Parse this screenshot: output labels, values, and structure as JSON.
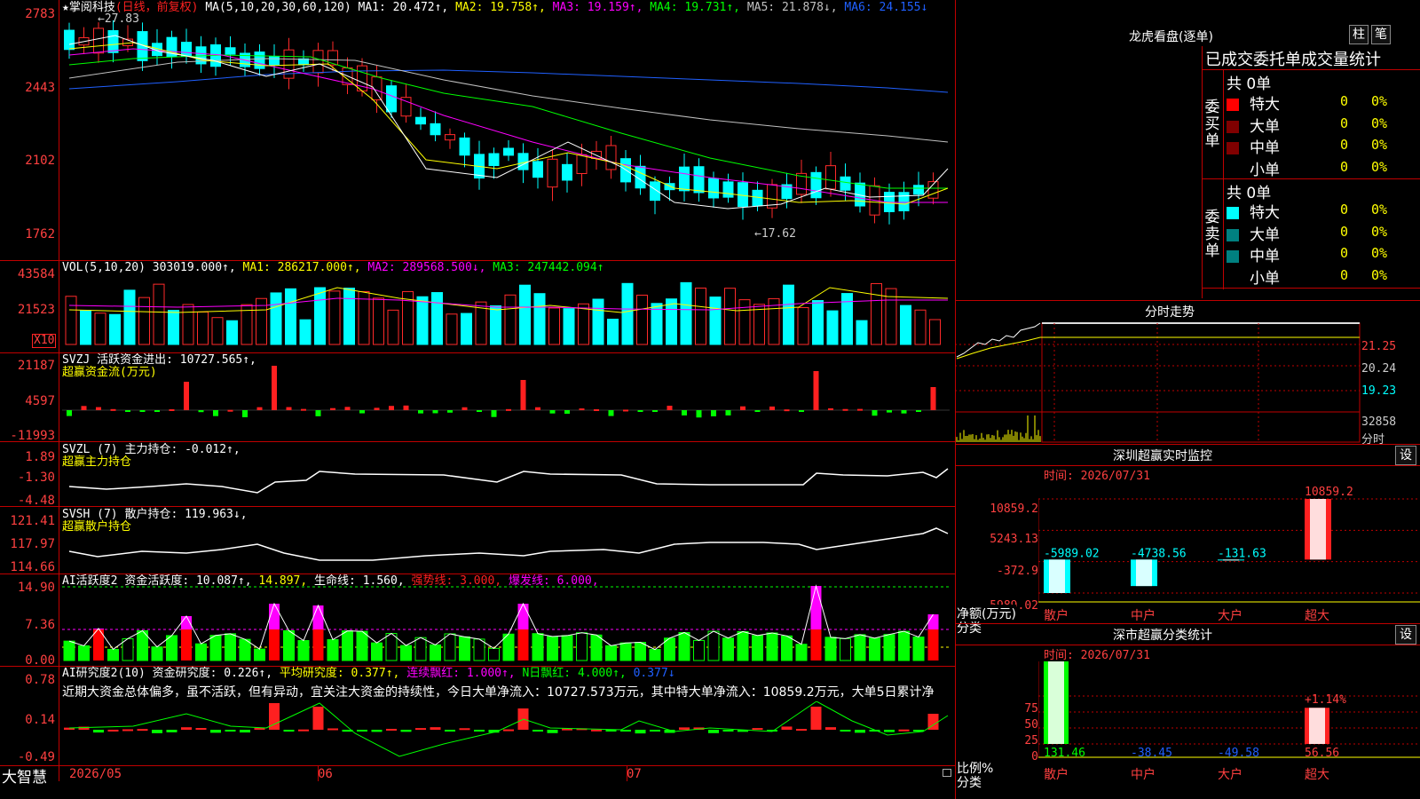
{
  "main": {
    "y_labels": [
      "2783",
      "2443",
      "2102",
      "1762"
    ],
    "header": {
      "stock": "★掌阅科技",
      "period": "(日线，前复权)",
      "ma": "MA(5,10,20,30,60,120)",
      "ma1": "MA1: 20.472↑,",
      "ma2": "MA2: 19.758↑,",
      "ma3": "MA3: 19.159↑,",
      "ma4": "MA4: 19.731↑,",
      "ma5": "MA5: 21.878↓,",
      "ma6": "MA6: 24.155↓"
    },
    "hi_label": "←27.83",
    "lo_label": "←17.62",
    "colors": {
      "up": "#ff2a2a",
      "down": "#00ffff",
      "ma1": "#ffffff",
      "ma2": "#ffff00",
      "ma3": "#ff00ff",
      "ma4": "#00ff00",
      "ma5": "#c0c0c0",
      "ma6": "#2060ff"
    }
  },
  "volume": {
    "y_labels": [
      "43584",
      "21523"
    ],
    "unit": "X10",
    "header": {
      "name": "VOL(5,10,20)",
      "val": "303019.000↑,",
      "ma1": "MA1: 286217.000↑,",
      "ma2": "MA2: 289568.500↓,",
      "ma3": "MA3: 247442.094↑"
    }
  },
  "svzj": {
    "y_labels": [
      "21187",
      "4597",
      "-11993"
    ],
    "header": {
      "name": "SVZJ",
      "val": "活跃资金进出: 10727.565↑,",
      "sub": "超赢资金流(万元)"
    }
  },
  "svzl": {
    "y_labels": [
      "1.89",
      "-1.30",
      "-4.48"
    ],
    "header": {
      "name": "SVZL (7) 主力持仓: -0.012↑,",
      "sub": "超赢主力持仓"
    }
  },
  "svsh": {
    "y_labels": [
      "121.41",
      "117.97",
      "114.66"
    ],
    "header": {
      "name": "SVSH (7) 散户持仓: 119.963↓,",
      "sub": "超赢散户持仓"
    }
  },
  "ai1": {
    "y_labels": [
      "14.90",
      "7.36",
      "0.00"
    ],
    "header": {
      "name": "AI活跃度2",
      "a": "资金活跃度: 10.087↑,",
      "b": "14.897,",
      "c": "生命线: 1.560,",
      "d": "强势线: 3.000,",
      "e": "爆发线: 6.000,"
    }
  },
  "ai2": {
    "y_labels": [
      "0.78",
      "0.14",
      "-0.49"
    ],
    "header": {
      "name": "AI研究度2(10)",
      "a": "资金研究度: 0.226↑,",
      "b": "平均研究度: 0.377↑,",
      "c": "连续飘红: 1.000↑,",
      "d": "N日飘红: 4.000↑,",
      "e": "0.377↓"
    },
    "comment": "近期大资金总体偏多，虽不活跃，但有异动，宜关注大资金的持续性，今日大单净流入：10727.573万元，其中特大单净流入：10859.2万元，大单5日累计净"
  },
  "xaxis": {
    "brand": "大智慧",
    "labels": [
      "2026/05",
      "06",
      "07"
    ]
  },
  "lhkp": {
    "title": "龙虎看盘(逐单)",
    "btn1": "柱",
    "btn2": "笔",
    "subtitle": "已成交委托单成交量统计",
    "buy_label": "委买单",
    "sell_label": "委卖单",
    "buy_total": "共 0单",
    "sell_total": "共 0单",
    "rows": [
      {
        "name": "特大",
        "count": "0",
        "pct": "0%"
      },
      {
        "name": "大单",
        "count": "0",
        "pct": "0%"
      },
      {
        "name": "中单",
        "count": "0",
        "pct": "0%"
      },
      {
        "name": "小单",
        "count": "0",
        "pct": "0%"
      }
    ],
    "buy_colors": [
      "#ff0000",
      "#800000",
      "#800000",
      "#000000"
    ],
    "sell_colors": [
      "#00ffff",
      "#008080",
      "#008080",
      "#000000"
    ]
  },
  "fenshi": {
    "title": "分时走势",
    "labels": [
      "21.25",
      "20.24",
      "19.23",
      "32858",
      "分时"
    ]
  },
  "sz_monitor": {
    "title": "深圳超赢实时监控",
    "btn": "设",
    "time": "时间: 2026/07/31",
    "y_labels": [
      "10859.2",
      "5243.13",
      "-372.9",
      "-5989.02"
    ],
    "unit": "净额(万元)",
    "cat_label": "分类",
    "cats": [
      "散户",
      "中户",
      "大户",
      "超大"
    ],
    "values": [
      -5989.02,
      -4738.56,
      -131.63,
      10859.2
    ],
    "value_labels": [
      "-5989.02",
      "-4738.56",
      "-131.63",
      "10859.2"
    ]
  },
  "sz_class": {
    "title": "深市超赢分类统计",
    "btn": "设",
    "time": "时间: 2026/07/31",
    "y_labels": [
      "75",
      "50",
      "25",
      "0"
    ],
    "unit": "比例%",
    "cat_label": "分类",
    "cats": [
      "散户",
      "中户",
      "大户",
      "超大"
    ],
    "values": [
      131.46,
      -38.45,
      -49.58,
      56.56
    ],
    "value_labels": [
      "131.46",
      "-38.45",
      "-49.58",
      "56.56"
    ],
    "top_label": "+1.14%"
  }
}
